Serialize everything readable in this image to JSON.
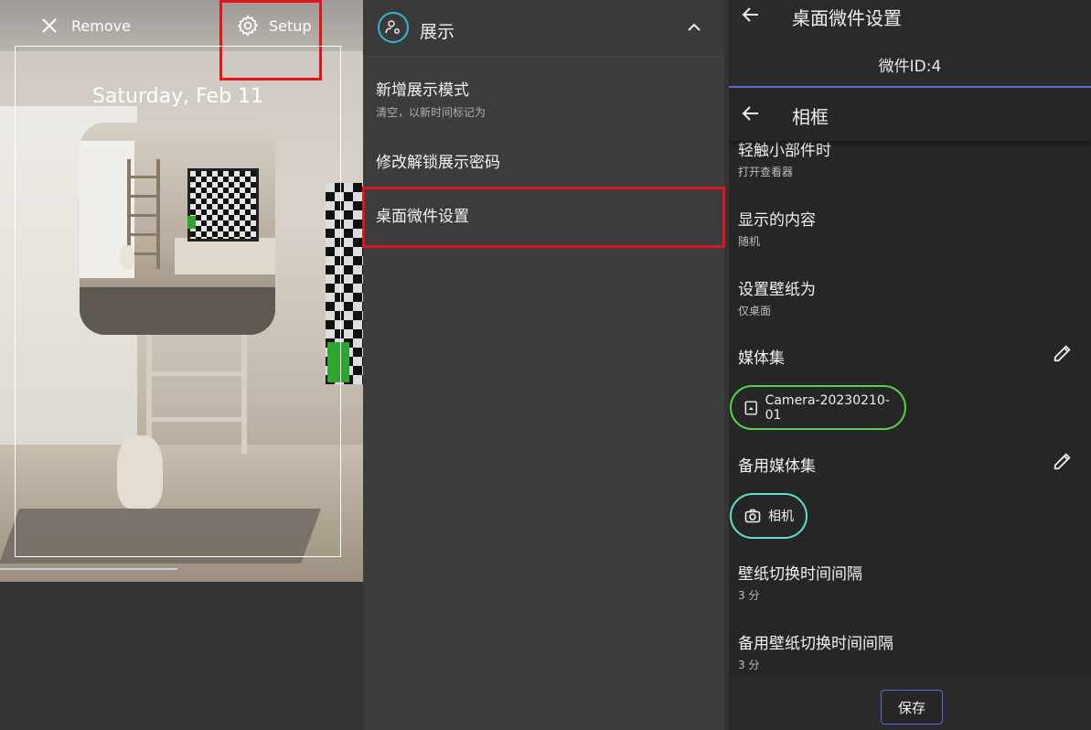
{
  "panel1": {
    "remove_label": "Remove",
    "setup_label": "Setup",
    "date_label": "Saturday, Feb 11"
  },
  "panel2": {
    "section_title": "展示",
    "items": [
      {
        "title": "新增展示模式",
        "subtitle": "清空，以新时间标记为"
      },
      {
        "title": "修改解锁展示密码",
        "subtitle": ""
      },
      {
        "title": "桌面微件设置",
        "subtitle": ""
      }
    ]
  },
  "panel3": {
    "title": "桌面微件设置",
    "widget_id": "微件ID:4",
    "subheader_title": "相框",
    "settings": {
      "tap_action": {
        "title": "轻触小部件时",
        "value": "打开查看器"
      },
      "content": {
        "title": "显示的内容",
        "value": "随机"
      },
      "wallpaper_target": {
        "title": "设置壁纸为",
        "value": "仅桌面"
      },
      "media_set": {
        "title": "媒体集",
        "chip": "Camera-20230210-01"
      },
      "backup_media_set": {
        "title": "备用媒体集",
        "chip": "相机"
      },
      "interval": {
        "title": "壁纸切换时间间隔",
        "value": "3 分"
      },
      "backup_interval": {
        "title": "备用壁纸切换时间间隔",
        "value": "3 分"
      }
    },
    "save_label": "保存"
  },
  "colors": {
    "highlight_red": "#e0151b",
    "accent_blue": "#5a6be0",
    "chip_green": "#58d24b",
    "chip_teal": "#5fe1d0",
    "icon_cyan": "#35b6d8"
  }
}
